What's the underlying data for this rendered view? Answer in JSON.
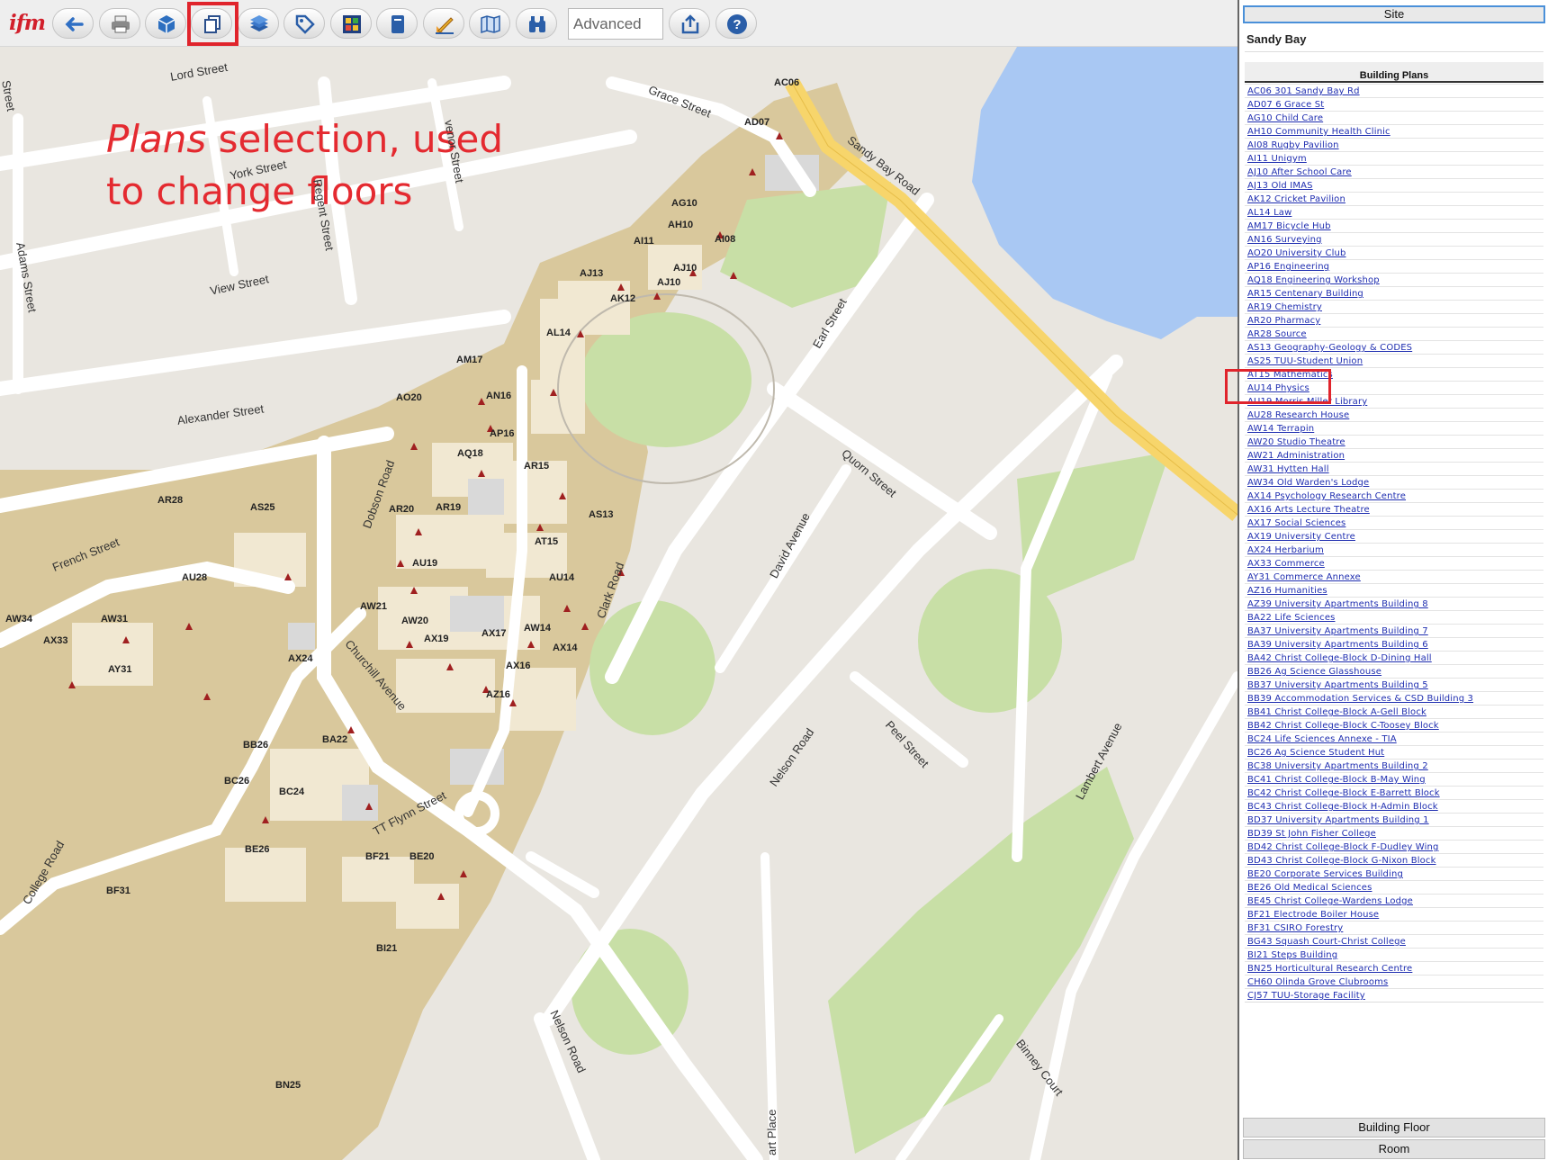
{
  "toolbar": {
    "logo": "ifm",
    "search_placeholder": "Advanced",
    "buttons": [
      {
        "name": "back-button",
        "icon": "arrow-left-icon"
      },
      {
        "name": "print-button",
        "icon": "printer-icon"
      },
      {
        "name": "3d-view-button",
        "icon": "cube-icon"
      },
      {
        "name": "plans-button",
        "icon": "plans-stack-icon"
      },
      {
        "name": "layers-button",
        "icon": "layers-icon"
      },
      {
        "name": "tag-button",
        "icon": "tag-icon"
      },
      {
        "name": "color-key-button",
        "icon": "color-grid-icon"
      },
      {
        "name": "book-button",
        "icon": "book-icon"
      },
      {
        "name": "measure-button",
        "icon": "pencil-ruler-icon"
      },
      {
        "name": "map-button",
        "icon": "open-map-icon"
      },
      {
        "name": "find-button",
        "icon": "binoculars-icon"
      },
      {
        "name": "share-button",
        "icon": "export-icon"
      },
      {
        "name": "help-button",
        "icon": "help-icon"
      }
    ]
  },
  "annotation": {
    "word_italic": "Plans",
    "line1_rest": " selection, used",
    "line2": "to change floors"
  },
  "map": {
    "streets": [
      "Lord Street",
      "Grace Street",
      "venor Street",
      "York Street",
      "Regent Street",
      "Adams Street",
      "View Street",
      "Alexander Street",
      "French Street",
      "Dobson Road",
      "Churchill Avenue",
      "TT Flynn Street",
      "College Road",
      "Clark Road",
      "Sandy Bay Road",
      "Earl Street",
      "Quorn Street",
      "David Avenue",
      "Nelson Road",
      "Peel Street",
      "Lambert Avenue",
      "Nelson Road",
      "Binney Court",
      "art Place",
      "Street"
    ],
    "buildings": [
      "AC06",
      "AD07",
      "AG10",
      "AH10",
      "AI11",
      "AI08",
      "AJ10",
      "AJ13",
      "AK12",
      "AJ10",
      "AL14",
      "AM17",
      "AN16",
      "AO20",
      "AP16",
      "AQ18",
      "AR15",
      "AR28",
      "AS25",
      "AR20",
      "AR19",
      "AS13",
      "AT15",
      "AU28",
      "AU19",
      "AU14",
      "AW34",
      "AW31",
      "AX33",
      "AW21",
      "AW20",
      "AX19",
      "AX17",
      "AW14",
      "AX14",
      "AX16",
      "AX24",
      "AY31",
      "AZ16",
      "BA22",
      "BB26",
      "BC26",
      "BC24",
      "BE26",
      "BF21",
      "BE20",
      "BF31",
      "BI21",
      "BN25"
    ]
  },
  "panel": {
    "site_tab": "Site",
    "site_name": "Sandy Bay",
    "plans_header": "Building Plans",
    "plans": [
      "AC06 301 Sandy Bay Rd",
      "AD07 6 Grace St",
      "AG10 Child Care",
      "AH10 Community Health Clinic",
      "AI08 Rugby Pavilion",
      "AI11 Unigym",
      "AJ10 After School Care",
      "AJ13 Old IMAS",
      "AK12 Cricket Pavilion",
      "AL14 Law",
      "AM17 Bicycle Hub",
      "AN16 Surveying",
      "AO20 University Club",
      "AP16 Engineering",
      "AQ18 Engineering Workshop",
      "AR15 Centenary Building",
      "AR19 Chemistry",
      "AR20 Pharmacy",
      "AR28 Source",
      "AS13 Geography-Geology & CODES",
      "AS25 TUU-Student Union",
      "AT15 Mathematics",
      "AU14 Physics",
      "AU19 Morris Miller Library",
      "AU28 Research House",
      "AW14 Terrapin",
      "AW20 Studio Theatre",
      "AW21 Administration",
      "AW31 Hytten Hall",
      "AW34 Old Warden's Lodge",
      "AX14 Psychology Research Centre",
      "AX16 Arts Lecture Theatre",
      "AX17 Social Sciences",
      "AX19 University Centre",
      "AX24 Herbarium",
      "AX33 Commerce",
      "AY31 Commerce Annexe",
      "AZ16 Humanities",
      "AZ39 University Apartments Building 8",
      "BA22 Life Sciences",
      "BA37 University Apartments Building 7",
      "BA39 University Apartments Building 6",
      "BA42 Christ College-Block D-Dining Hall",
      "BB26 Ag Science Glasshouse",
      "BB37 University Apartments Building 5",
      "BB39 Accommodation Services & CSD Building 3",
      "BB41 Christ College-Block A-Gell Block",
      "BB42 Christ College-Block C-Toosey Block",
      "BC24 Life Sciences Annexe - TIA",
      "BC26 Ag Science Student Hut",
      "BC38 University Apartments Building 2",
      "BC41 Christ College-Block B-May Wing",
      "BC42 Christ College-Block E-Barrett Block",
      "BC43 Christ College-Block H-Admin Block",
      "BD37 University Apartments Building 1",
      "BD39 St John Fisher College",
      "BD42 Christ College-Block F-Dudley Wing",
      "BD43 Christ College-Block G-Nixon Block",
      "BE20 Corporate Services Building",
      "BE26 Old Medical Sciences",
      "BE45 Christ College-Wardens Lodge",
      "BF21 Electrode Boiler House",
      "BF31 CSIRO Forestry",
      "BG43 Squash Court-Christ College",
      "BI21 Steps Building",
      "BN25 Horticultural Research Centre",
      "CH60 Olinda Grove Clubrooms",
      "CJ57 TUU-Storage Facility"
    ],
    "building_floor_tab": "Building Floor",
    "room_tab": "Room"
  },
  "colors": {
    "highlight": "#e0242c",
    "link": "#1f2eb0",
    "road_major": "#f7d56b",
    "water": "#a9c8f3",
    "campus": "#d9c89c",
    "park": "#c8dfa6"
  }
}
